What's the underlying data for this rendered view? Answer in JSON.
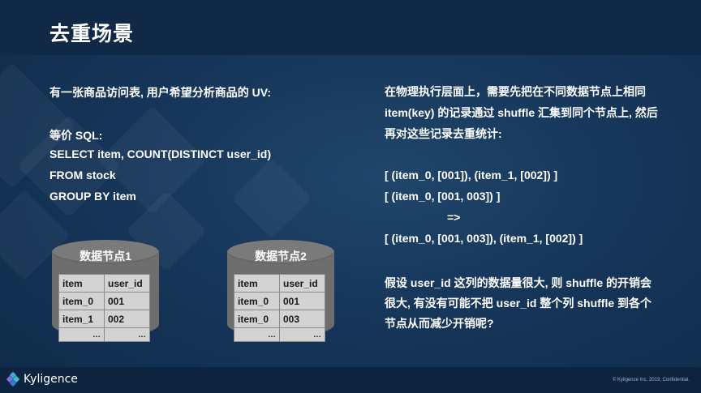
{
  "slide": {
    "title": "去重场景"
  },
  "left": {
    "intro": "有一张商品访问表, 用户希望分析商品的 UV:",
    "sql_label": "等价 SQL:",
    "sql_lines": [
      "SELECT item, COUNT(DISTINCT user_id)",
      "FROM stock",
      "GROUP BY item"
    ]
  },
  "nodes": [
    {
      "label": "数据节点1",
      "header": [
        "item",
        "user_id"
      ],
      "rows": [
        [
          "item_0",
          "001"
        ],
        [
          "item_1",
          "002"
        ]
      ],
      "dots": [
        "…",
        "…"
      ]
    },
    {
      "label": "数据节点2",
      "header": [
        "item",
        "user_id"
      ],
      "rows": [
        [
          "item_0",
          "001"
        ],
        [
          "item_0",
          "003"
        ]
      ],
      "dots": [
        "…",
        "…"
      ]
    }
  ],
  "right": {
    "para1": [
      "在物理执行层面上，需要先把在不同数据节点上相同",
      "item(key) 的记录通过 shuffle 汇集到同个节点上, 然后",
      "再对这些记录去重统计:"
    ],
    "lines": [
      "[ (item_0, [001]), (item_1, [002]) ]",
      "[ (item_0, [001, 003]) ]",
      "=>",
      "[ (item_0, [001, 003]), (item_1, [002]) ]"
    ],
    "para2": [
      "假设  user_id  这列的数据量很大, 则  shuffle  的开销会",
      "很大, 有没有可能不把  user_id  整个列  shuffle  到各个",
      "节点从而减少开销呢?"
    ]
  },
  "footer": {
    "logo": "Kyligence",
    "copyright": "© Kyligence Inc. 2019, Confidential."
  },
  "colors": {
    "background": "#16365a",
    "header": "#0f2946",
    "cylinder": "#6e6e6e",
    "cell": "#d3d3d3"
  }
}
